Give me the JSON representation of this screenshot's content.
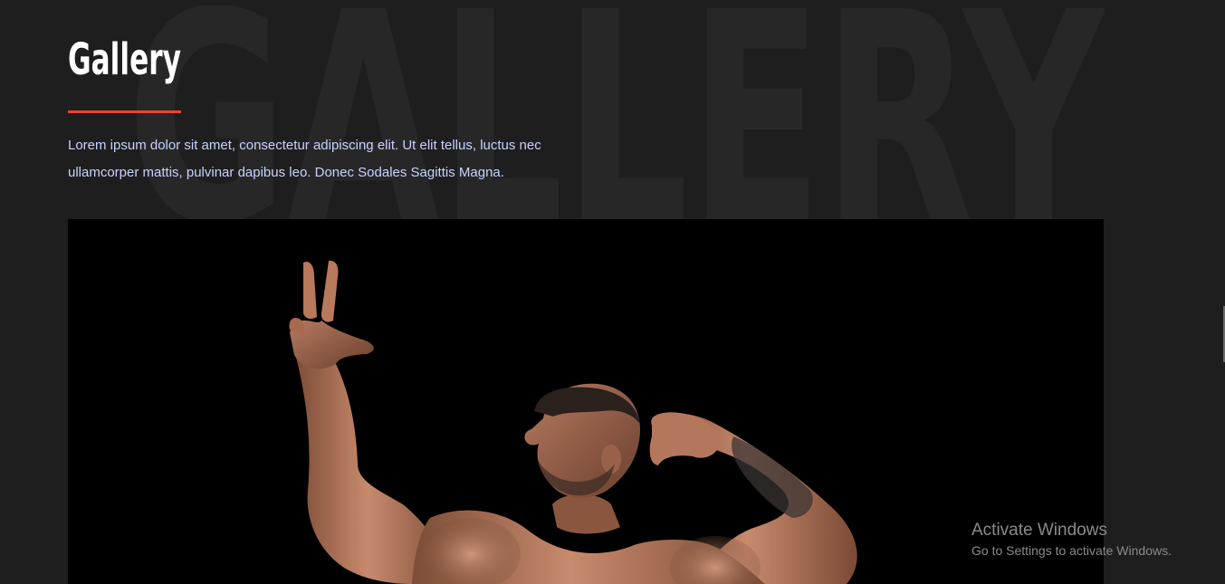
{
  "section": {
    "watermark_text": "GALLERY",
    "title": "Gallery",
    "description": "Lorem ipsum dolor sit amet, consectetur adipiscing elit. Ut elit tellus, luctus nec ullamcorper mattis, pulvinar dapibus leo. Donec Sodales Sagittis Magna."
  },
  "system_notice": {
    "title": "Activate Windows",
    "subtitle": "Go to Settings to activate Windows."
  },
  "colors": {
    "background": "#1e1e1e",
    "accent": "#e2463a",
    "description_text": "#c6d3ff",
    "watermark": "#272727"
  }
}
